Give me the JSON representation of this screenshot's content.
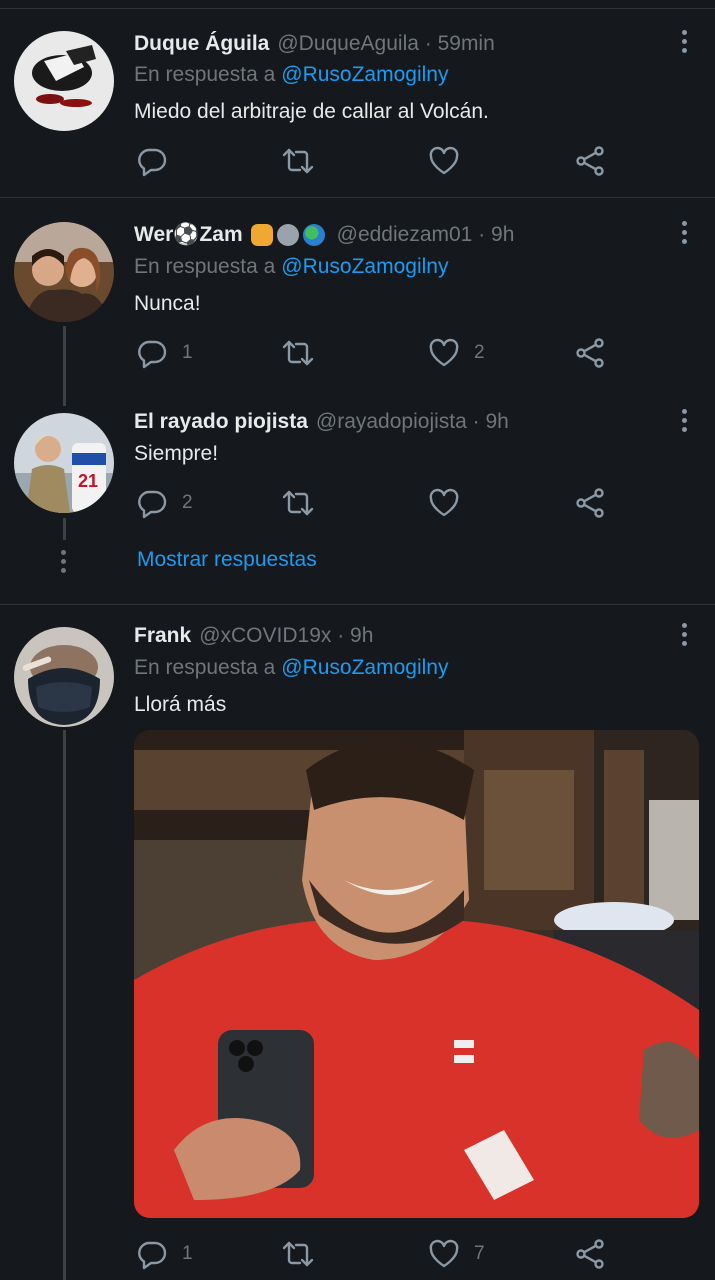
{
  "colors": {
    "background": "#15181c",
    "text_primary": "#e7e9ea",
    "text_secondary": "#71767b",
    "accent": "#1d9bf0",
    "divider": "#2f3336"
  },
  "icons": {
    "reply": "speech-bubble-icon",
    "retweet": "retweet-arrows-icon",
    "like": "heart-icon",
    "share": "share-nodes-icon",
    "more": "vertical-dots-icon"
  },
  "tweets": [
    {
      "name": "Duque Águila",
      "handle": "@DuqueAguila · 59min",
      "reply_prefix": "En respuesta a",
      "reply_to": "@RusoZamogilny",
      "text": "Miedo del arbitraje de callar al Volcán.",
      "replies": "",
      "retweets": "",
      "likes": ""
    },
    {
      "name": "Wer⚽Zam",
      "handle": "@eddiezam01 · 9h",
      "reply_prefix": "En respuesta a",
      "reply_to": "@RusoZamogilny",
      "text": "Nunca!",
      "replies": "1",
      "retweets": "",
      "likes": "2"
    },
    {
      "name": "El rayado piojista",
      "handle": "@rayadopiojista · 9h",
      "text": "Siempre!",
      "replies": "2",
      "retweets": "",
      "likes": ""
    },
    {
      "name": "Frank",
      "handle": "@xCOVID19x · 9h",
      "reply_prefix": "En respuesta a",
      "reply_to": "@RusoZamogilny",
      "text": "Llorá más",
      "replies": "1",
      "retweets": "",
      "likes": "7"
    }
  ],
  "show_replies": "Mostrar respuestas"
}
